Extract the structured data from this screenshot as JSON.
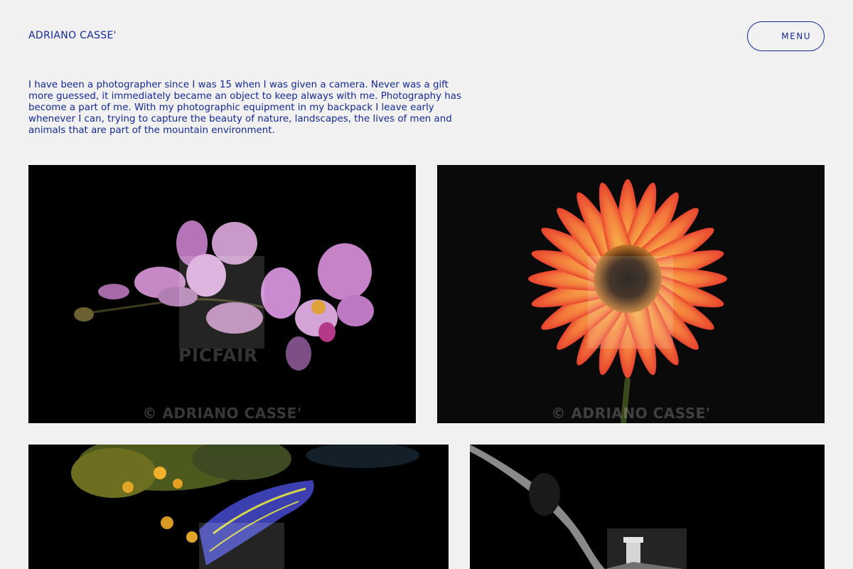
{
  "header": {
    "brand": "ADRIANO CASSE'",
    "menu_label": "MENU"
  },
  "intro": {
    "text": "I have been a photographer since I was 15 when I was given a camera. Never was a gift more guessed, it immediately became an object to keep always with me. Photography has become a part of me. With my photographic equipment in my backpack I leave early whenever I can, trying to capture the beauty of nature, landscapes, the lives of men and animals that are part of the mountain environment."
  },
  "gallery": {
    "watermark_brand": "PICFAIR",
    "watermark_copyright": "© ADRIANO CASSE'"
  },
  "colors": {
    "accent": "#14289a",
    "background": "#f1f1f1"
  }
}
